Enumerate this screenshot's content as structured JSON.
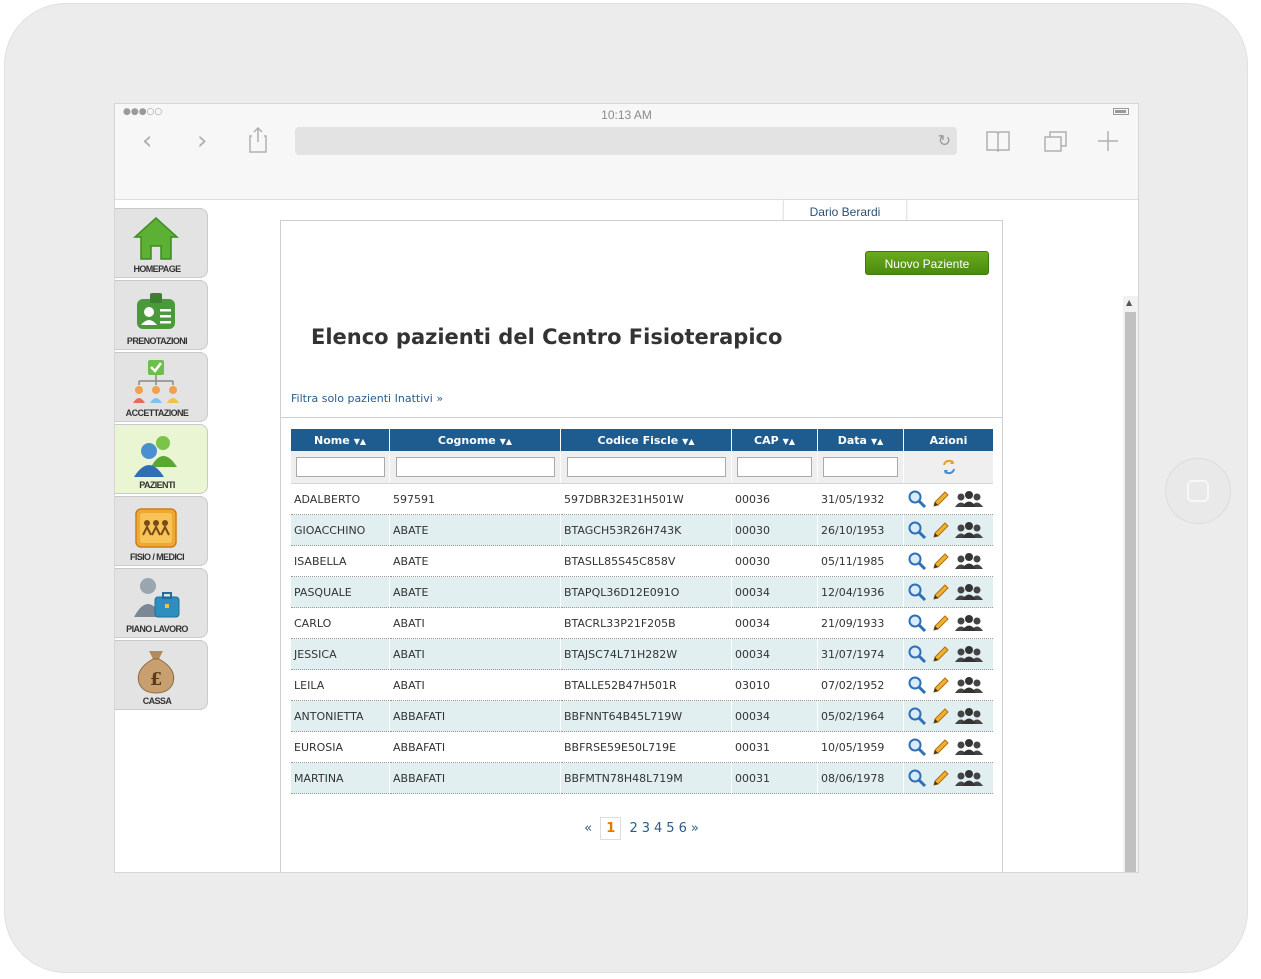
{
  "status": {
    "signal": "●●●○○",
    "time": "10:13 AM"
  },
  "user": {
    "name": "Dario Berardi"
  },
  "sidebar": {
    "items": [
      {
        "label": "HOMEPAGE",
        "icon": "home-icon"
      },
      {
        "label": "PRENOTAZIONI",
        "icon": "id-card-icon"
      },
      {
        "label": "ACCETTAZIONE",
        "icon": "org-chart-icon"
      },
      {
        "label": "PAZIENTI",
        "icon": "patients-icon",
        "active": true
      },
      {
        "label": "FISIO / MEDICI",
        "icon": "staff-icon"
      },
      {
        "label": "PIANO LAVORO",
        "icon": "briefcase-icon"
      },
      {
        "label": "CASSA",
        "icon": "money-bag-icon"
      }
    ]
  },
  "main": {
    "new_button": "Nuovo Paziente",
    "title": "Elenco pazienti del Centro Fisioterapico",
    "filter_link": "Filtra solo pazienti Inattivi »",
    "sort_glyph": "▼▲",
    "table": {
      "columns": [
        "Nome",
        "Cognome",
        "Codice Fiscle",
        "CAP",
        "Data",
        "Azioni"
      ],
      "rows": [
        [
          "ADALBERTO",
          "597591",
          "597DBR32E31H501W",
          "00036",
          "31/05/1932"
        ],
        [
          "GIOACCHINO",
          "ABATE",
          "BTAGCH53R26H743K",
          "00030",
          "26/10/1953"
        ],
        [
          "ISABELLA",
          "ABATE",
          "BTASLL85S45C858V",
          "00030",
          "05/11/1985"
        ],
        [
          "PASQUALE",
          "ABATE",
          "BTAPQL36D12E091O",
          "00034",
          "12/04/1936"
        ],
        [
          "CARLO",
          "ABATI",
          "BTACRL33P21F205B",
          "00034",
          "21/09/1933"
        ],
        [
          "JESSICA",
          "ABATI",
          "BTAJSC74L71H282W",
          "00034",
          "31/07/1974"
        ],
        [
          "LEILA",
          "ABATI",
          "BTALLE52B47H501R",
          "03010",
          "07/02/1952"
        ],
        [
          "ANTONIETTA",
          "ABBAFATI",
          "BBFNNT64B45L719W",
          "00034",
          "05/02/1964"
        ],
        [
          "EUROSIA",
          "ABBAFATI",
          "BBFRSE59E50L719E",
          "00031",
          "10/05/1959"
        ],
        [
          "MARTINA",
          "ABBAFATI",
          "BBFMTN78H48L719M",
          "00031",
          "08/06/1978"
        ]
      ]
    },
    "pager": {
      "prev": "«",
      "current": "1",
      "pages": [
        "2",
        "3",
        "4",
        "5",
        "6"
      ],
      "next": "»"
    }
  }
}
